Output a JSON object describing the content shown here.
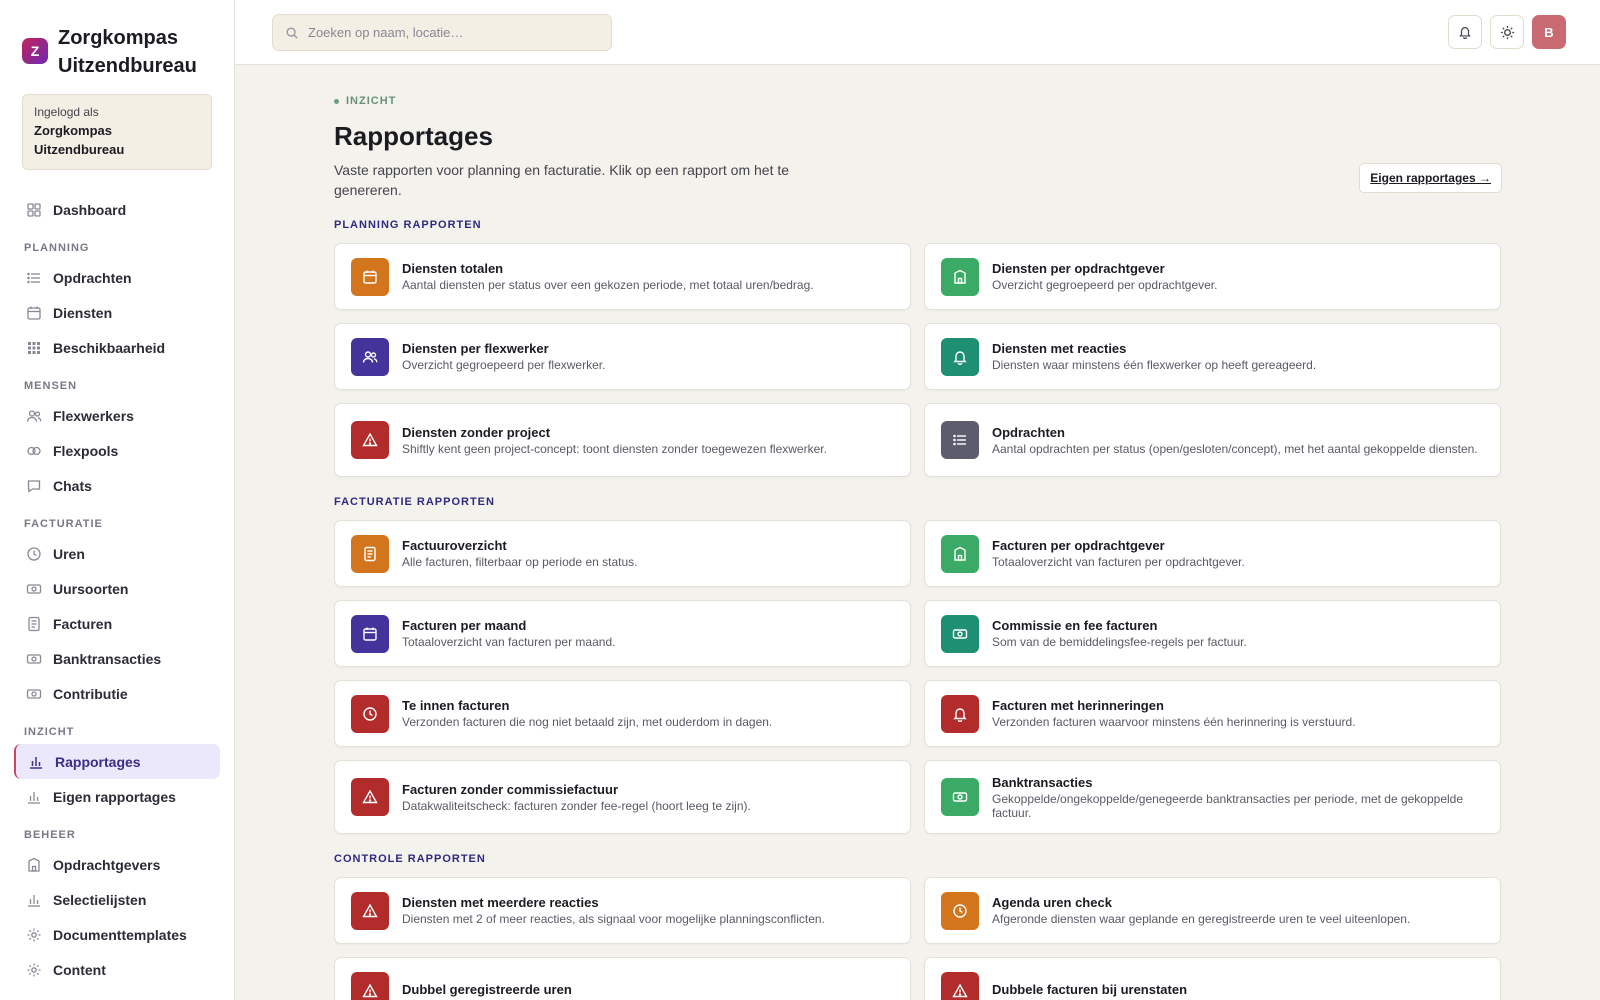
{
  "brand": {
    "logo_letter": "Z",
    "name": "Zorgkompas Uitzendbureau"
  },
  "login": {
    "label": "Ingelogd als",
    "name": "Zorgkompas Uitzendbureau"
  },
  "nav": {
    "dashboard": "Dashboard",
    "sections": {
      "planning": "PLANNING",
      "mensen": "MENSEN",
      "facturatie": "FACTURATIE",
      "inzicht": "INZICHT",
      "beheer": "BEHEER"
    },
    "items": {
      "opdrachten": "Opdrachten",
      "diensten": "Diensten",
      "beschikbaarheid": "Beschikbaarheid",
      "flexwerkers": "Flexwerkers",
      "flexpools": "Flexpools",
      "chats": "Chats",
      "uren": "Uren",
      "uursoorten": "Uursoorten",
      "facturen": "Facturen",
      "banktransacties": "Banktransacties",
      "contributie": "Contributie",
      "rapportages": "Rapportages",
      "eigen_rapportages": "Eigen rapportages",
      "opdrachtgevers": "Opdrachtgevers",
      "selectielijsten": "Selectielijsten",
      "documenttemplates": "Documenttemplates",
      "content": "Content"
    }
  },
  "search": {
    "placeholder": "Zoeken op naam, locatie…",
    "value": ""
  },
  "user": {
    "avatar_letter": "B"
  },
  "page": {
    "eyebrow": "INZICHT",
    "title": "Rapportages",
    "subtitle": "Vaste rapporten voor planning en facturatie. Klik op een rapport om het te genereren.",
    "custom_link": "Eigen rapportages →"
  },
  "sections": {
    "planning": {
      "title": "PLANNING RAPPORTEN",
      "cards": [
        {
          "title": "Diensten totalen",
          "desc": "Aantal diensten per status over een gekozen periode, met totaal uren/bedrag.",
          "icon": "calendar-icon",
          "color": "#d3751c"
        },
        {
          "title": "Diensten per opdrachtgever",
          "desc": "Overzicht gegroepeerd per opdrachtgever.",
          "icon": "building-icon",
          "color": "#3aaa66"
        },
        {
          "title": "Diensten per flexwerker",
          "desc": "Overzicht gegroepeerd per flexwerker.",
          "icon": "users-icon",
          "color": "#43339b"
        },
        {
          "title": "Diensten met reacties",
          "desc": "Diensten waar minstens één flexwerker op heeft gereageerd.",
          "icon": "bell-icon",
          "color": "#1f8f73"
        },
        {
          "title": "Diensten zonder project",
          "desc": "Shiftly kent geen project-concept: toont diensten zonder toegewezen flexwerker.",
          "icon": "warning-icon",
          "color": "#b22c2c"
        },
        {
          "title": "Opdrachten",
          "desc": "Aantal opdrachten per status (open/gesloten/concept), met het aantal gekoppelde diensten.",
          "icon": "list-icon",
          "color": "#5d5b6e"
        }
      ]
    },
    "facturatie": {
      "title": "FACTURATIE RAPPORTEN",
      "cards": [
        {
          "title": "Factuuroverzicht",
          "desc": "Alle facturen, filterbaar op periode en status.",
          "icon": "document-icon",
          "color": "#d3751c"
        },
        {
          "title": "Facturen per opdrachtgever",
          "desc": "Totaaloverzicht van facturen per opdrachtgever.",
          "icon": "building-icon",
          "color": "#3aaa66"
        },
        {
          "title": "Facturen per maand",
          "desc": "Totaaloverzicht van facturen per maand.",
          "icon": "calendar-icon",
          "color": "#43339b"
        },
        {
          "title": "Commissie en fee facturen",
          "desc": "Som van de bemiddelingsfee-regels per factuur.",
          "icon": "money-icon",
          "color": "#1f8f73"
        },
        {
          "title": "Te innen facturen",
          "desc": "Verzonden facturen die nog niet betaald zijn, met ouderdom in dagen.",
          "icon": "clock-icon",
          "color": "#b22c2c"
        },
        {
          "title": "Facturen met herinneringen",
          "desc": "Verzonden facturen waarvoor minstens één herinnering is verstuurd.",
          "icon": "bell-icon",
          "color": "#b22c2c"
        },
        {
          "title": "Facturen zonder commissiefactuur",
          "desc": "Datakwaliteitscheck: facturen zonder fee-regel (hoort leeg te zijn).",
          "icon": "warning-icon",
          "color": "#b22c2c"
        },
        {
          "title": "Banktransacties",
          "desc": "Gekoppelde/ongekoppelde/genegeerde banktransacties per periode, met de gekoppelde factuur.",
          "icon": "money-icon",
          "color": "#3aaa66"
        }
      ]
    },
    "controle": {
      "title": "CONTROLE RAPPORTEN",
      "cards": [
        {
          "title": "Diensten met meerdere reacties",
          "desc": "Diensten met 2 of meer reacties, als signaal voor mogelijke planningsconflicten.",
          "icon": "warning-icon",
          "color": "#b22c2c"
        },
        {
          "title": "Agenda uren check",
          "desc": "Afgeronde diensten waar geplande en geregistreerde uren te veel uiteenlopen.",
          "icon": "clock-icon",
          "color": "#d3751c"
        },
        {
          "title": "Dubbel geregistreerde uren",
          "desc": "",
          "icon": "warning-icon",
          "color": "#b22c2c"
        },
        {
          "title": "Dubbele facturen bij urenstaten",
          "desc": "",
          "icon": "warning-icon",
          "color": "#b22c2c"
        }
      ]
    }
  }
}
